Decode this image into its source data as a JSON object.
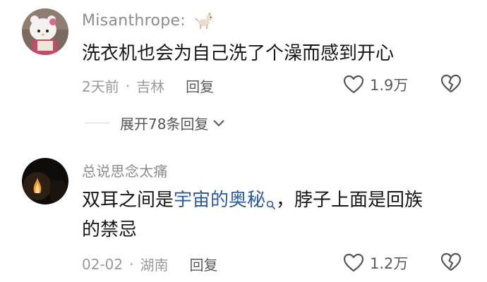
{
  "comments": [
    {
      "username": "Misanthrope:",
      "badge_icon": "dog-emoji-icon",
      "text": "洗衣机也会为自己洗了个澡而感到开心",
      "time": "2天前",
      "location": "吉林",
      "reply_label": "回复",
      "likes": "1.9万",
      "replies_label": "展开78条回复"
    },
    {
      "username": "总说思念太痛",
      "text_before": "双耳之间是",
      "search_term": "宇宙的奥秘",
      "text_after": "，脖子上面是回族",
      "text_line2": "的禁忌",
      "time": "02-02",
      "location": "湖南",
      "reply_label": "回复",
      "likes": "1.2万"
    }
  ],
  "colors": {
    "link": "#2c5aa0",
    "text": "#161616",
    "muted": "#9a9a9a"
  }
}
